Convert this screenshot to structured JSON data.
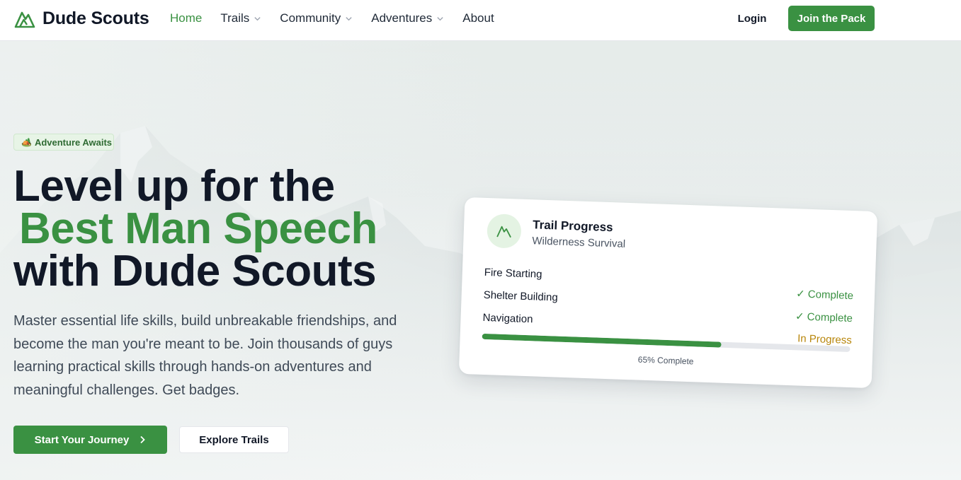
{
  "header": {
    "brand": "Dude Scouts",
    "nav": [
      {
        "label": "Home",
        "active": true,
        "dropdown": false
      },
      {
        "label": "Trails",
        "active": false,
        "dropdown": true
      },
      {
        "label": "Community",
        "active": false,
        "dropdown": true
      },
      {
        "label": "Adventures",
        "active": false,
        "dropdown": true
      },
      {
        "label": "About",
        "active": false,
        "dropdown": false
      }
    ],
    "login_label": "Login",
    "join_label": "Join the Pack"
  },
  "hero": {
    "badge_icon": "🏕️",
    "badge_label": "Adventure Awaits",
    "headline_line1": "Level up for the",
    "headline_highlight": "Best Man Speech",
    "headline_line3": "with Dude Scouts",
    "subtext": "Master essential life skills, build unbreakable friendships, and become the man you're meant to be. Join thousands of guys learning practical skills through hands-on adventures and meaningful challenges. Get badges.",
    "primary_cta": "Start Your Journey",
    "secondary_cta": "Explore Trails"
  },
  "progress_card": {
    "title": "Trail Progress",
    "subtitle": "Wilderness Survival",
    "skills": [
      {
        "name": "Fire Starting",
        "status": "✓ Complete",
        "state": "complete"
      },
      {
        "name": "Shelter Building",
        "status": "✓ Complete",
        "state": "complete"
      },
      {
        "name": "Navigation",
        "status": "In Progress",
        "state": "progress"
      }
    ],
    "progress_percent": 65,
    "progress_label": "65% Complete"
  },
  "colors": {
    "brand_green": "#3a9142",
    "in_progress": "#b8860b",
    "text_dark": "#111827"
  },
  "icons": {
    "logo": "mountain-icon",
    "nav_dropdown": "chevron-down-icon",
    "cta_arrow": "chevron-right-icon",
    "card": "mountain-icon"
  }
}
